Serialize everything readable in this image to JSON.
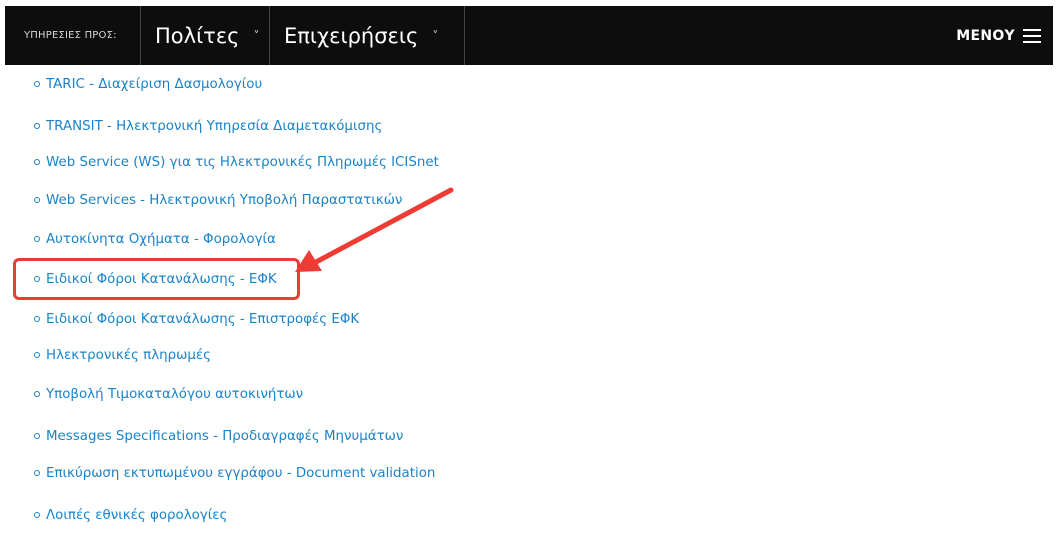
{
  "header": {
    "services_label": "ΥΠΗΡΕΣΙΕΣ ΠΡΟΣ:",
    "tabs": [
      {
        "label": "Πολίτες",
        "caret": "˅"
      },
      {
        "label": "Επιχειρήσεις",
        "caret": "˅"
      }
    ],
    "menu_label": "ΜΕΝΟΥ"
  },
  "links": [
    "TARIC - Διαχείριση Δασμολογίου",
    "TRANSIT - Ηλεκτρονική Υπηρεσία Διαμετακόμισης",
    "Web Service (WS) για τις Ηλεκτρονικές Πληρωμές ICISnet",
    "Web Services - Ηλεκτρονική Υποβολή Παραστατικών",
    "Αυτοκίνητα Οχήματα - Φορολογία",
    "Ειδικοί Φόροι Κατανάλωσης - ΕΦΚ",
    "Ειδικοί Φόροι Κατανάλωσης - Επιστροφές ΕΦΚ",
    "Ηλεκτρονικές πληρωμές",
    "Υποβολή Τιμοκαταλόγου αυτοκινήτων",
    "Messages Specifications - Προδιαγραφές Μηνυμάτων",
    "Επικύρωση εκτυπωμένου εγγράφου - Document validation",
    "Λοιπές εθνικές φορολογίες"
  ],
  "annotation": {
    "highlighted_link_index": 5,
    "color": "#ee3b33"
  },
  "colors": {
    "link": "#1a83c8",
    "header_bg": "#0d0d0d"
  }
}
